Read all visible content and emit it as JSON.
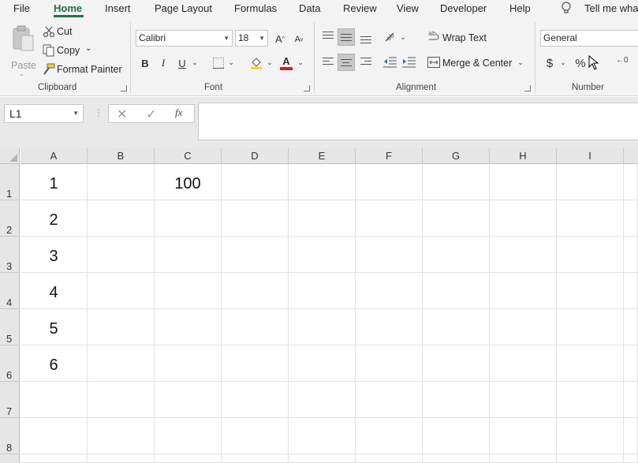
{
  "tabs": [
    "File",
    "Home",
    "Insert",
    "Page Layout",
    "Formulas",
    "Data",
    "Review",
    "View",
    "Developer",
    "Help"
  ],
  "tell_me": "Tell me wha",
  "clipboard": {
    "paste": "Paste",
    "cut": "Cut",
    "copy": "Copy",
    "format_painter": "Format Painter",
    "group_label": "Clipboard"
  },
  "font": {
    "name": "Calibri",
    "size": "18",
    "bold": "B",
    "italic": "I",
    "underline": "U",
    "group_label": "Font",
    "font_color": "#e81123"
  },
  "alignment": {
    "wrap_text": "Wrap Text",
    "merge_center": "Merge & Center",
    "group_label": "Alignment"
  },
  "number": {
    "format": "General",
    "currency": "$",
    "percent": "%",
    "group_label": "Number"
  },
  "formula_bar": {
    "name_box": "L1",
    "fx": "fx",
    "formula": ""
  },
  "grid": {
    "columns": [
      "A",
      "B",
      "C",
      "D",
      "E",
      "F",
      "G",
      "H",
      "I"
    ],
    "rows": [
      "1",
      "2",
      "3",
      "4",
      "5",
      "6",
      "7",
      "8"
    ],
    "cells": {
      "A1": "1",
      "A2": "2",
      "A3": "3",
      "A4": "4",
      "A5": "5",
      "A6": "6",
      "C1": "100"
    }
  },
  "colors": {
    "accent": "#217346"
  }
}
